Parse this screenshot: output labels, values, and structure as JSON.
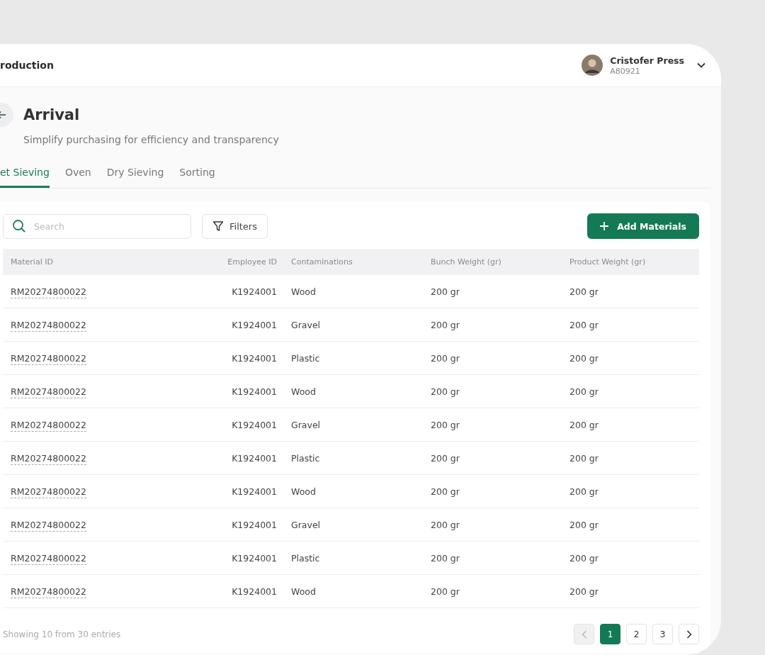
{
  "app": {
    "title": "roduction"
  },
  "user": {
    "name": "Cristofer Press",
    "id": "A80921"
  },
  "page": {
    "title": "Arrival",
    "subtitle": "Simplify purchasing for efficiency and transparency"
  },
  "tabs": [
    {
      "label": "et Sieving",
      "selected": true
    },
    {
      "label": "Oven",
      "selected": false
    },
    {
      "label": "Dry Sieving",
      "selected": false
    },
    {
      "label": "Sorting",
      "selected": false
    }
  ],
  "search": {
    "placeholder": "Search"
  },
  "filters_button": "Filters",
  "add_button": "Add Materials",
  "table": {
    "columns": [
      "Material ID",
      "Employee ID",
      "Contaminations",
      "Bunch Weight (gr)",
      "Product Weight (gr)"
    ],
    "rows": [
      [
        "RM20274800022",
        "K1924001",
        "Wood",
        "200 gr",
        "200 gr"
      ],
      [
        "RM20274800022",
        "K1924001",
        "Gravel",
        "200 gr",
        "200 gr"
      ],
      [
        "RM20274800022",
        "K1924001",
        "Plastic",
        "200 gr",
        "200 gr"
      ],
      [
        "RM20274800022",
        "K1924001",
        "Wood",
        "200 gr",
        "200 gr"
      ],
      [
        "RM20274800022",
        "K1924001",
        "Gravel",
        "200 gr",
        "200 gr"
      ],
      [
        "RM20274800022",
        "K1924001",
        "Plastic",
        "200 gr",
        "200 gr"
      ],
      [
        "RM20274800022",
        "K1924001",
        "Wood",
        "200 gr",
        "200 gr"
      ],
      [
        "RM20274800022",
        "K1924001",
        "Gravel",
        "200 gr",
        "200 gr"
      ],
      [
        "RM20274800022",
        "K1924001",
        "Plastic",
        "200 gr",
        "200 gr"
      ],
      [
        "RM20274800022",
        "K1924001",
        "Wood",
        "200 gr",
        "200 gr"
      ]
    ]
  },
  "footer": {
    "summary": "Showing 10 from 30 entries"
  },
  "pagination": {
    "prev_disabled": true,
    "pages": [
      {
        "label": "1",
        "selected": true
      },
      {
        "label": "2",
        "selected": false
      },
      {
        "label": "3",
        "selected": false
      }
    ]
  }
}
